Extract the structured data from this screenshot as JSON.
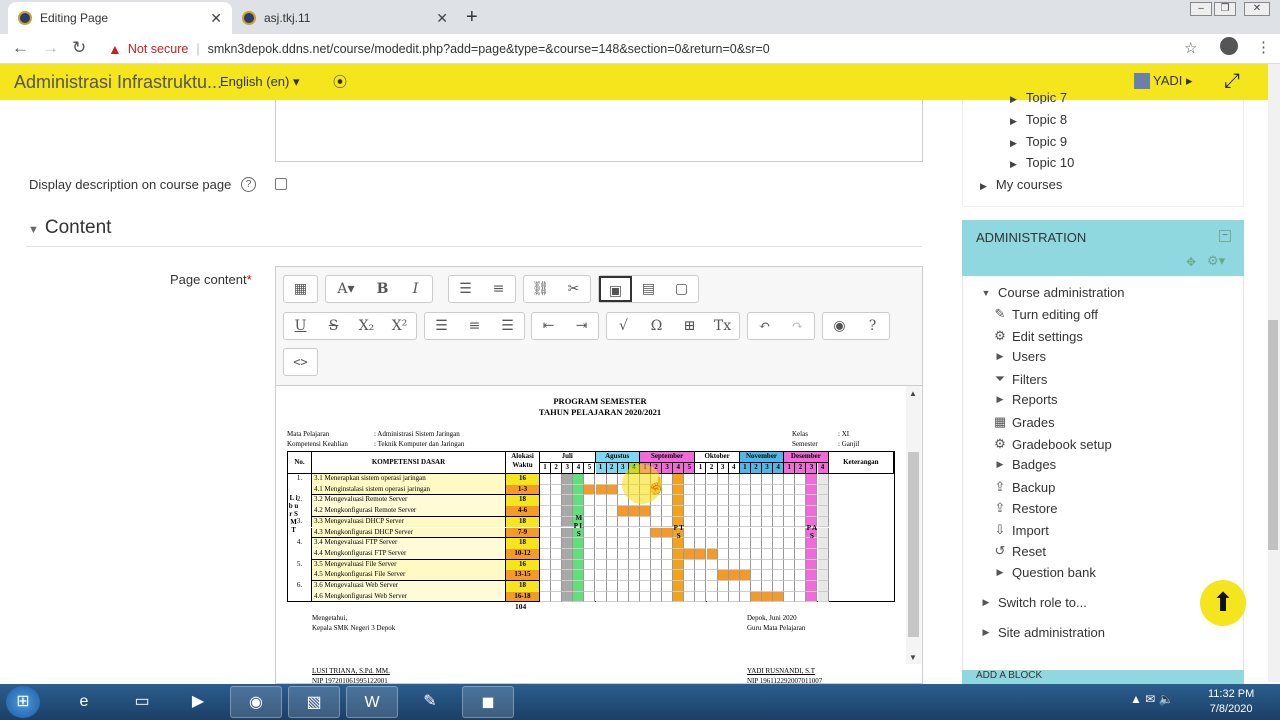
{
  "browser": {
    "tabs": [
      {
        "title": "Editing Page"
      },
      {
        "title": "asj.tkj.11"
      }
    ],
    "security": "Not secure",
    "url": "smkn3depok.ddns.net/course/modedit.php?add=page&type=&course=148&section=0&return=0&sr=0"
  },
  "moodle": {
    "site_name": "Administrasi Infrastruktu...",
    "language": "English (en) ▾",
    "user": "YADI ▸"
  },
  "form": {
    "display_desc_label": "Display description on course page",
    "help": "?",
    "section_title": "Content",
    "page_content_label": "Page content",
    "required": "*"
  },
  "document": {
    "title1": "PROGRAM  SEMESTER",
    "title2": "TAHUN PELAJARAN 2020/2021",
    "mapel_label": "Mata Pelajaran",
    "mapel_value": ": Administrasi Sistem Jaringan",
    "kk_label": "Kompetensi Keahlian",
    "kk_value": ": Teknik Komputer dan Jaringan",
    "kelas_label": "Kelas",
    "kelas_value": ": XI",
    "semester_label": "Semester",
    "semester_value": ": Ganjil",
    "headers": {
      "no": "No.",
      "kd": "KOMPETENSI DASAR",
      "alokasi": "Alokasi Waktu",
      "ket": "Keterangan"
    },
    "months": [
      "Juli",
      "Agustus",
      "September",
      "Oktober",
      "November",
      "Desember"
    ],
    "weeks_juli": [
      "1",
      "2",
      "3",
      "4",
      "5"
    ],
    "weeks_4": [
      "1",
      "2",
      "3",
      "4"
    ],
    "weeks_5": [
      "1",
      "2",
      "3",
      "4",
      "5"
    ],
    "rows": [
      {
        "no": "1.",
        "kd": "3.1 Menerapkan sistem operasi jaringan",
        "aw": "16"
      },
      {
        "no": "",
        "kd": "4.1 Menginstalasi sistem operasi jaringan",
        "aw": "1-3"
      },
      {
        "no": "2.",
        "kd": "3.2 Mengevaluasi Remote Server",
        "aw": "18"
      },
      {
        "no": "",
        "kd": "4.2 Mengkonfigurasi Remote Server",
        "aw": "4-6"
      },
      {
        "no": "3.",
        "kd": "3.3 Mengevaluasi DHCP Server",
        "aw": "18"
      },
      {
        "no": "",
        "kd": "4.3 Mengkonfigurasi DHCP Server",
        "aw": "7-9"
      },
      {
        "no": "4.",
        "kd": "3.4 Mengevaluasi FTP Server",
        "aw": "18"
      },
      {
        "no": "",
        "kd": "4.4 Mengkonfigurasi FTP Server",
        "aw": "10-12"
      },
      {
        "no": "5.",
        "kd": "3.5 Mengevaluasi File Server",
        "aw": "16"
      },
      {
        "no": "",
        "kd": "4.5 Mengkonfigurasi File Server",
        "aw": "13-15"
      },
      {
        "no": "6.",
        "kd": "3.6 Mengevaluasi Web Server",
        "aw": "18"
      },
      {
        "no": "",
        "kd": "4.6 Mengkonfigurasi Web Server",
        "aw": "16-18"
      }
    ],
    "total": "104",
    "mpls": "M P L S",
    "pts": "P T S",
    "pas": "P A S",
    "libur": "L i b u r   S M T",
    "mengetahui": "Mengetahui,",
    "kepsek": "Kepala SMK Negeri 3 Depok",
    "tempat": "Depok,   Juni 2020",
    "guru": "Guru Mata Pelajaran",
    "nama_kepsek": "LUSI TRIANA, S.Pd. MM.",
    "nama_guru": "YADI RUSNANDI, S.T",
    "nip_kepsek": "NIP 197201061995122001",
    "nip_guru": "NIP 196112292007011007"
  },
  "sidebar": {
    "tree": [
      {
        "label": "Topic 7"
      },
      {
        "label": "Topic 8"
      },
      {
        "label": "Topic 9"
      },
      {
        "label": "Topic 10"
      },
      {
        "label": "My courses"
      }
    ],
    "admin_title": "ADMINISTRATION",
    "admin_items": [
      {
        "label": "Course administration"
      },
      {
        "label": "Turn editing off"
      },
      {
        "label": "Edit settings"
      },
      {
        "label": "Users"
      },
      {
        "label": "Filters"
      },
      {
        "label": "Reports"
      },
      {
        "label": "Grades"
      },
      {
        "label": "Gradebook setup"
      },
      {
        "label": "Badges"
      },
      {
        "label": "Backup"
      },
      {
        "label": "Restore"
      },
      {
        "label": "Import"
      },
      {
        "label": "Reset"
      },
      {
        "label": "Question bank"
      },
      {
        "label": "Switch role to..."
      },
      {
        "label": "Site administration"
      }
    ],
    "add_block": "ADD A BLOCK"
  },
  "taskbar": {
    "time": "11:32 PM",
    "date": "7/8/2020"
  }
}
